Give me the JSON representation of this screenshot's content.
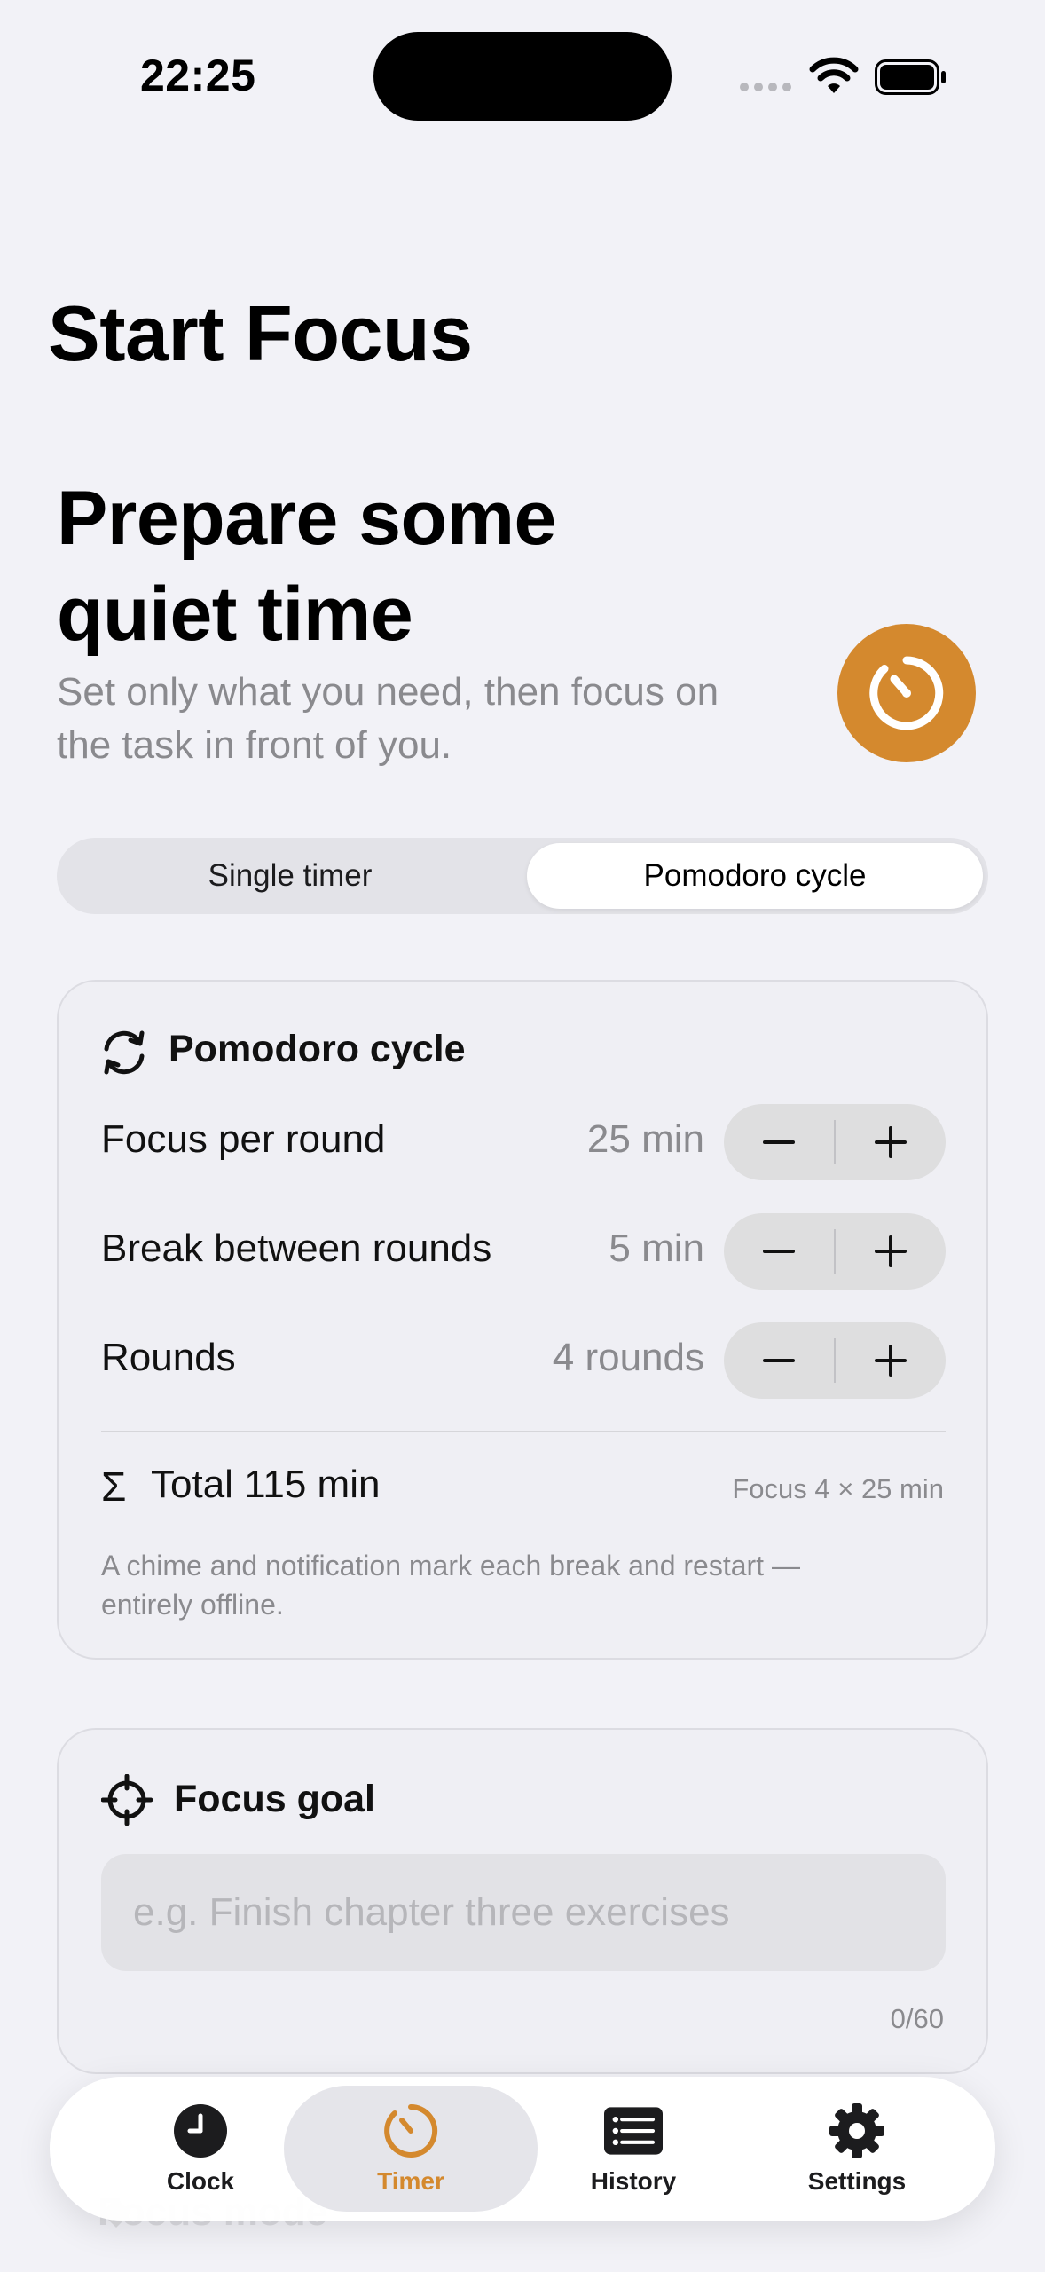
{
  "status_bar": {
    "time": "22:25"
  },
  "nav": {
    "title": "Start Focus"
  },
  "hero": {
    "title_line1": "Prepare some",
    "title_line2": "quiet time",
    "subtitle_line1": "Set only what you need, then focus on",
    "subtitle_line2": "the task in front of you.",
    "accent_color": "#d4892e",
    "icon": "timer-icon"
  },
  "mode_picker": {
    "options": [
      "Single timer",
      "Pomodoro cycle"
    ],
    "selected": "Pomodoro cycle"
  },
  "pomodoro": {
    "title": "Pomodoro cycle",
    "icon": "cycle-icon",
    "rows": [
      {
        "label": "Focus per round",
        "value": "25 min"
      },
      {
        "label": "Break between rounds",
        "value": "5 min"
      },
      {
        "label": "Rounds",
        "value": "4 rounds"
      }
    ],
    "total_symbol": "Σ",
    "total": "Total 115 min",
    "total_note": "Focus 4 × 25 min",
    "footnote_line1": "A chime and notification mark each break and restart —",
    "footnote_line2": "entirely offline."
  },
  "goal": {
    "title": "Focus goal",
    "icon": "crosshair-icon",
    "value": "",
    "placeholder": "e.g. Finish chapter three exercises",
    "char_count": "0/60"
  },
  "peek": {
    "label": "Focus mode"
  },
  "tabbar": {
    "tabs": [
      {
        "label": "Clock",
        "icon": "clock-icon"
      },
      {
        "label": "Timer",
        "icon": "timer-icon"
      },
      {
        "label": "History",
        "icon": "list-icon"
      },
      {
        "label": "Settings",
        "icon": "gear-icon"
      }
    ],
    "active": "Timer"
  }
}
